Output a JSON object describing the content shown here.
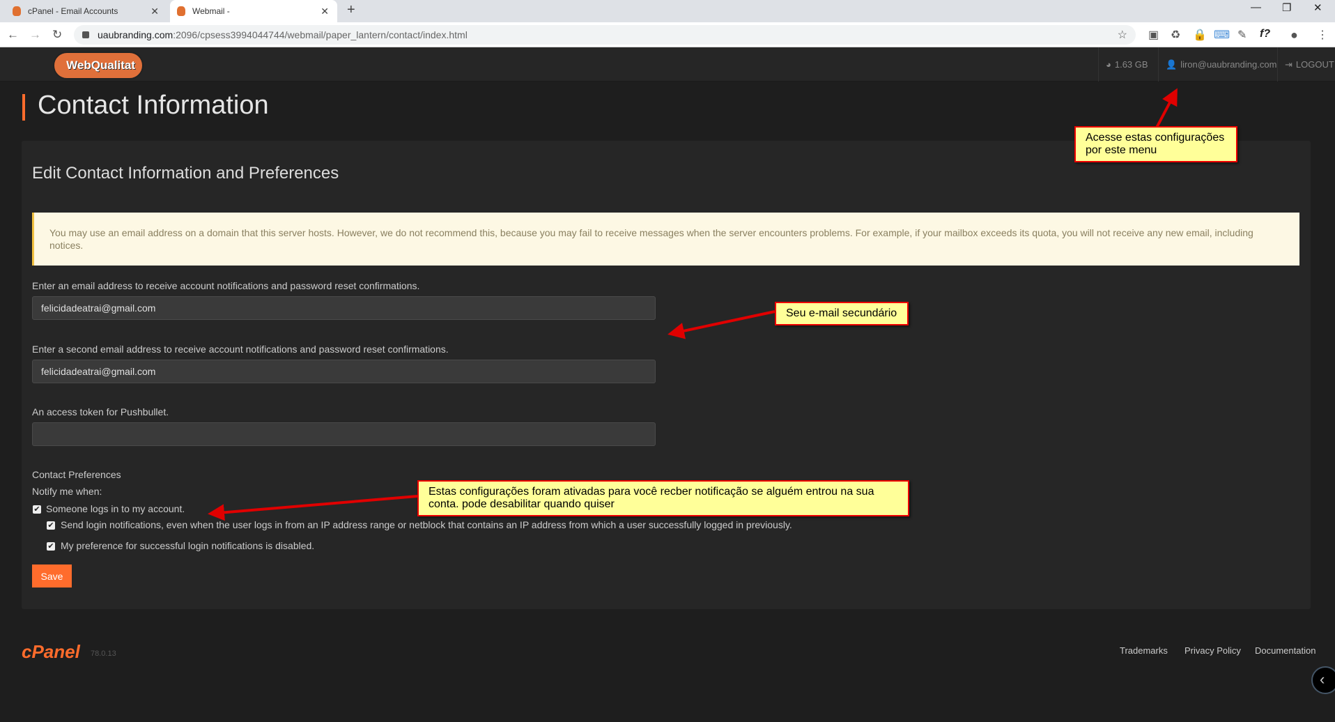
{
  "browser": {
    "tabs": [
      {
        "label": "cPanel - Email Accounts"
      },
      {
        "label": "Webmail -"
      }
    ],
    "url_host": "uaubranding.com",
    "url_path": ":2096/cpsess3994044744/webmail/paper_lantern/contact/index.html"
  },
  "header": {
    "logo": "WebQualitat",
    "disk_usage": "1.63 GB",
    "user": "liron@uaubranding.com",
    "logout": "LOGOUT"
  },
  "page": {
    "title": "Contact Information",
    "subtitle": "Edit Contact Information and Preferences",
    "alert": "You may use an email address on a domain that this server hosts. However, we do not recommend this, because you may fail to receive messages when the server encounters problems. For example, if your mailbox exceeds its quota, you will not receive any new email, including notices.",
    "fields": [
      {
        "label": "Enter an email address to receive account notifications and password reset confirmations.",
        "value": "felicidadeatrai@gmail.com"
      },
      {
        "label": "Enter a second email address to receive account notifications and password reset confirmations.",
        "value": "felicidadeatrai@gmail.com"
      },
      {
        "label": "An access token for Pushbullet.",
        "value": ""
      }
    ],
    "preferences_heading": "Contact Preferences",
    "notify_label": "Notify me when:",
    "checkboxes": [
      {
        "label": "Someone logs in to my account.",
        "checked": true
      },
      {
        "label": "Send login notifications, even when the user logs in from an IP address range or netblock that contains an IP address from which a user successfully logged in previously.",
        "checked": true
      },
      {
        "label": "My preference for successful login notifications is disabled.",
        "checked": true
      }
    ],
    "save": "Save"
  },
  "footer": {
    "brand": "cPanel",
    "version": "78.0.13",
    "links": [
      "Trademarks",
      "Privacy Policy",
      "Documentation"
    ]
  },
  "annotations": [
    "Acesse estas configurações por este menu",
    "Seu e-mail secundário",
    "Estas configurações foram ativadas para você recber notificação se alguém entrou na sua conta. pode desabilitar quando quiser"
  ],
  "colors": {
    "accent": "#ff6c2c",
    "callout_bg": "#ffff99",
    "arrow": "#e00000"
  }
}
